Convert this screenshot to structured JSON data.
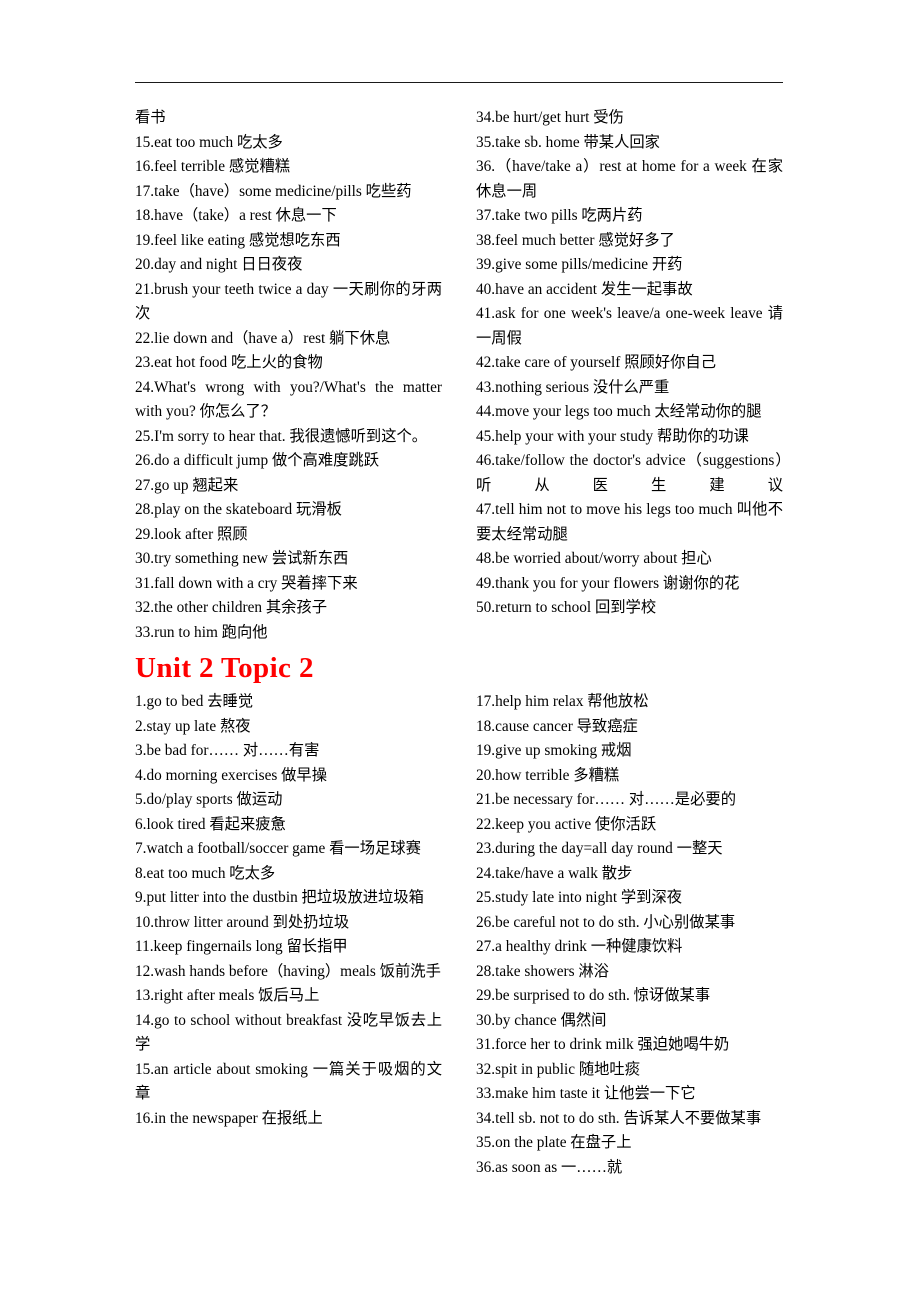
{
  "document": {
    "title": "Unit 2 Topic 1 / Topic 2 English-Chinese phrase list",
    "header_rule": "horizontal-rule"
  },
  "sections": [
    {
      "id": "unit2-topic1-continued",
      "heading": null,
      "left_column": [
        "看书",
        "15.eat too much  吃太多",
        "16.feel terrible  感觉糟糕",
        "17.take（have）some medicine/pills  吃些药",
        "18.have（take）a rest  休息一下",
        "19.feel like eating  感觉想吃东西",
        "20.day and night  日日夜夜",
        "21.brush your teeth twice a day  一天刷你的牙两次",
        "22.lie down and（have a）rest  躺下休息",
        "23.eat hot food  吃上火的食物",
        "24.What's wrong with you?/What's the matter with you?  你怎么了？",
        "25.I'm sorry to hear that.  我很遗憾听到这个。",
        "26.do a difficult jump  做个高难度跳跃",
        "27.go up 翘起来",
        "28.play on the skateboard  玩滑板",
        "29.look after  照顾",
        "30.try something new  尝试新东西",
        "31.fall down with a cry  哭着摔下来",
        "32.the other children  其余孩子",
        "33.run to him  跑向他"
      ],
      "right_column": [
        "34.be hurt/get hurt  受伤",
        "35.take sb. home  带某人回家",
        "36.（have/take a）rest at home for a week  在家休息一周",
        "37.take two pills  吃两片药",
        "38.feel much better  感觉好多了",
        "39.give some pills/medicine  开药",
        "40.have an accident  发生一起事故",
        "41.ask for one week's leave/a one-week leave  请一周假",
        "42.take care of yourself  照顾好你自己",
        "43.nothing serious  没什么严重",
        "44.move your legs too much  太经常动你的腿",
        "45.help your with your study  帮助你的功课",
        "46.take/follow the doctor's advice（suggestions）听从医生建议",
        "47.tell him not to move his legs too much  叫他不要太经常动腿",
        "48.be worried about/worry about  担心",
        "49.thank you for your flowers  谢谢你的花",
        "50.return to school  回到学校"
      ]
    },
    {
      "id": "unit2-topic2",
      "heading": "Unit 2 Topic 2",
      "left_column": [
        "1.go to bed  去睡觉",
        "2.stay up late  熬夜",
        "3.be bad for……  对……有害",
        "4.do morning exercises  做早操",
        "5.do/play sports  做运动",
        "6.look tired  看起来疲惫",
        "7.watch a football/soccer game  看一场足球赛",
        "8.eat too much  吃太多",
        "9.put litter into the dustbin  把垃圾放进垃圾箱",
        "10.throw litter around  到处扔垃圾",
        "11.keep fingernails long  留长指甲",
        "12.wash hands before（having）meals  饭前洗手",
        "13.right after meals  饭后马上",
        "14.go to school without breakfast  没吃早饭去上学",
        "15.an article about smoking  一篇关于吸烟的文章",
        "16.in the newspaper  在报纸上"
      ],
      "right_column": [
        "17.help him relax  帮他放松",
        "18.cause cancer  导致癌症",
        "19.give up smoking  戒烟",
        "20.how terrible  多糟糕",
        "21.be necessary for……  对……是必要的",
        "22.keep you active  使你活跃",
        "23.during the day=all day round  一整天",
        "24.take/have a walk  散步",
        "25.study late into night  学到深夜",
        "26.be careful not to do sth.  小心别做某事",
        "27.a healthy drink  一种健康饮料",
        "28.take showers  淋浴",
        "29.be surprised to do sth.  惊讶做某事",
        "30.by chance  偶然间",
        "31.force her to drink milk  强迫她喝牛奶",
        "32.spit in public  随地吐痰",
        "33.make him taste it  让他尝一下它",
        "34.tell sb. not to do sth.  告诉某人不要做某事",
        "35.on the plate  在盘子上",
        "36.as soon as  一……就"
      ]
    }
  ],
  "colors": {
    "heading_red": "#ff0000",
    "text_black": "#000000",
    "rule": "#1a1a1a"
  }
}
